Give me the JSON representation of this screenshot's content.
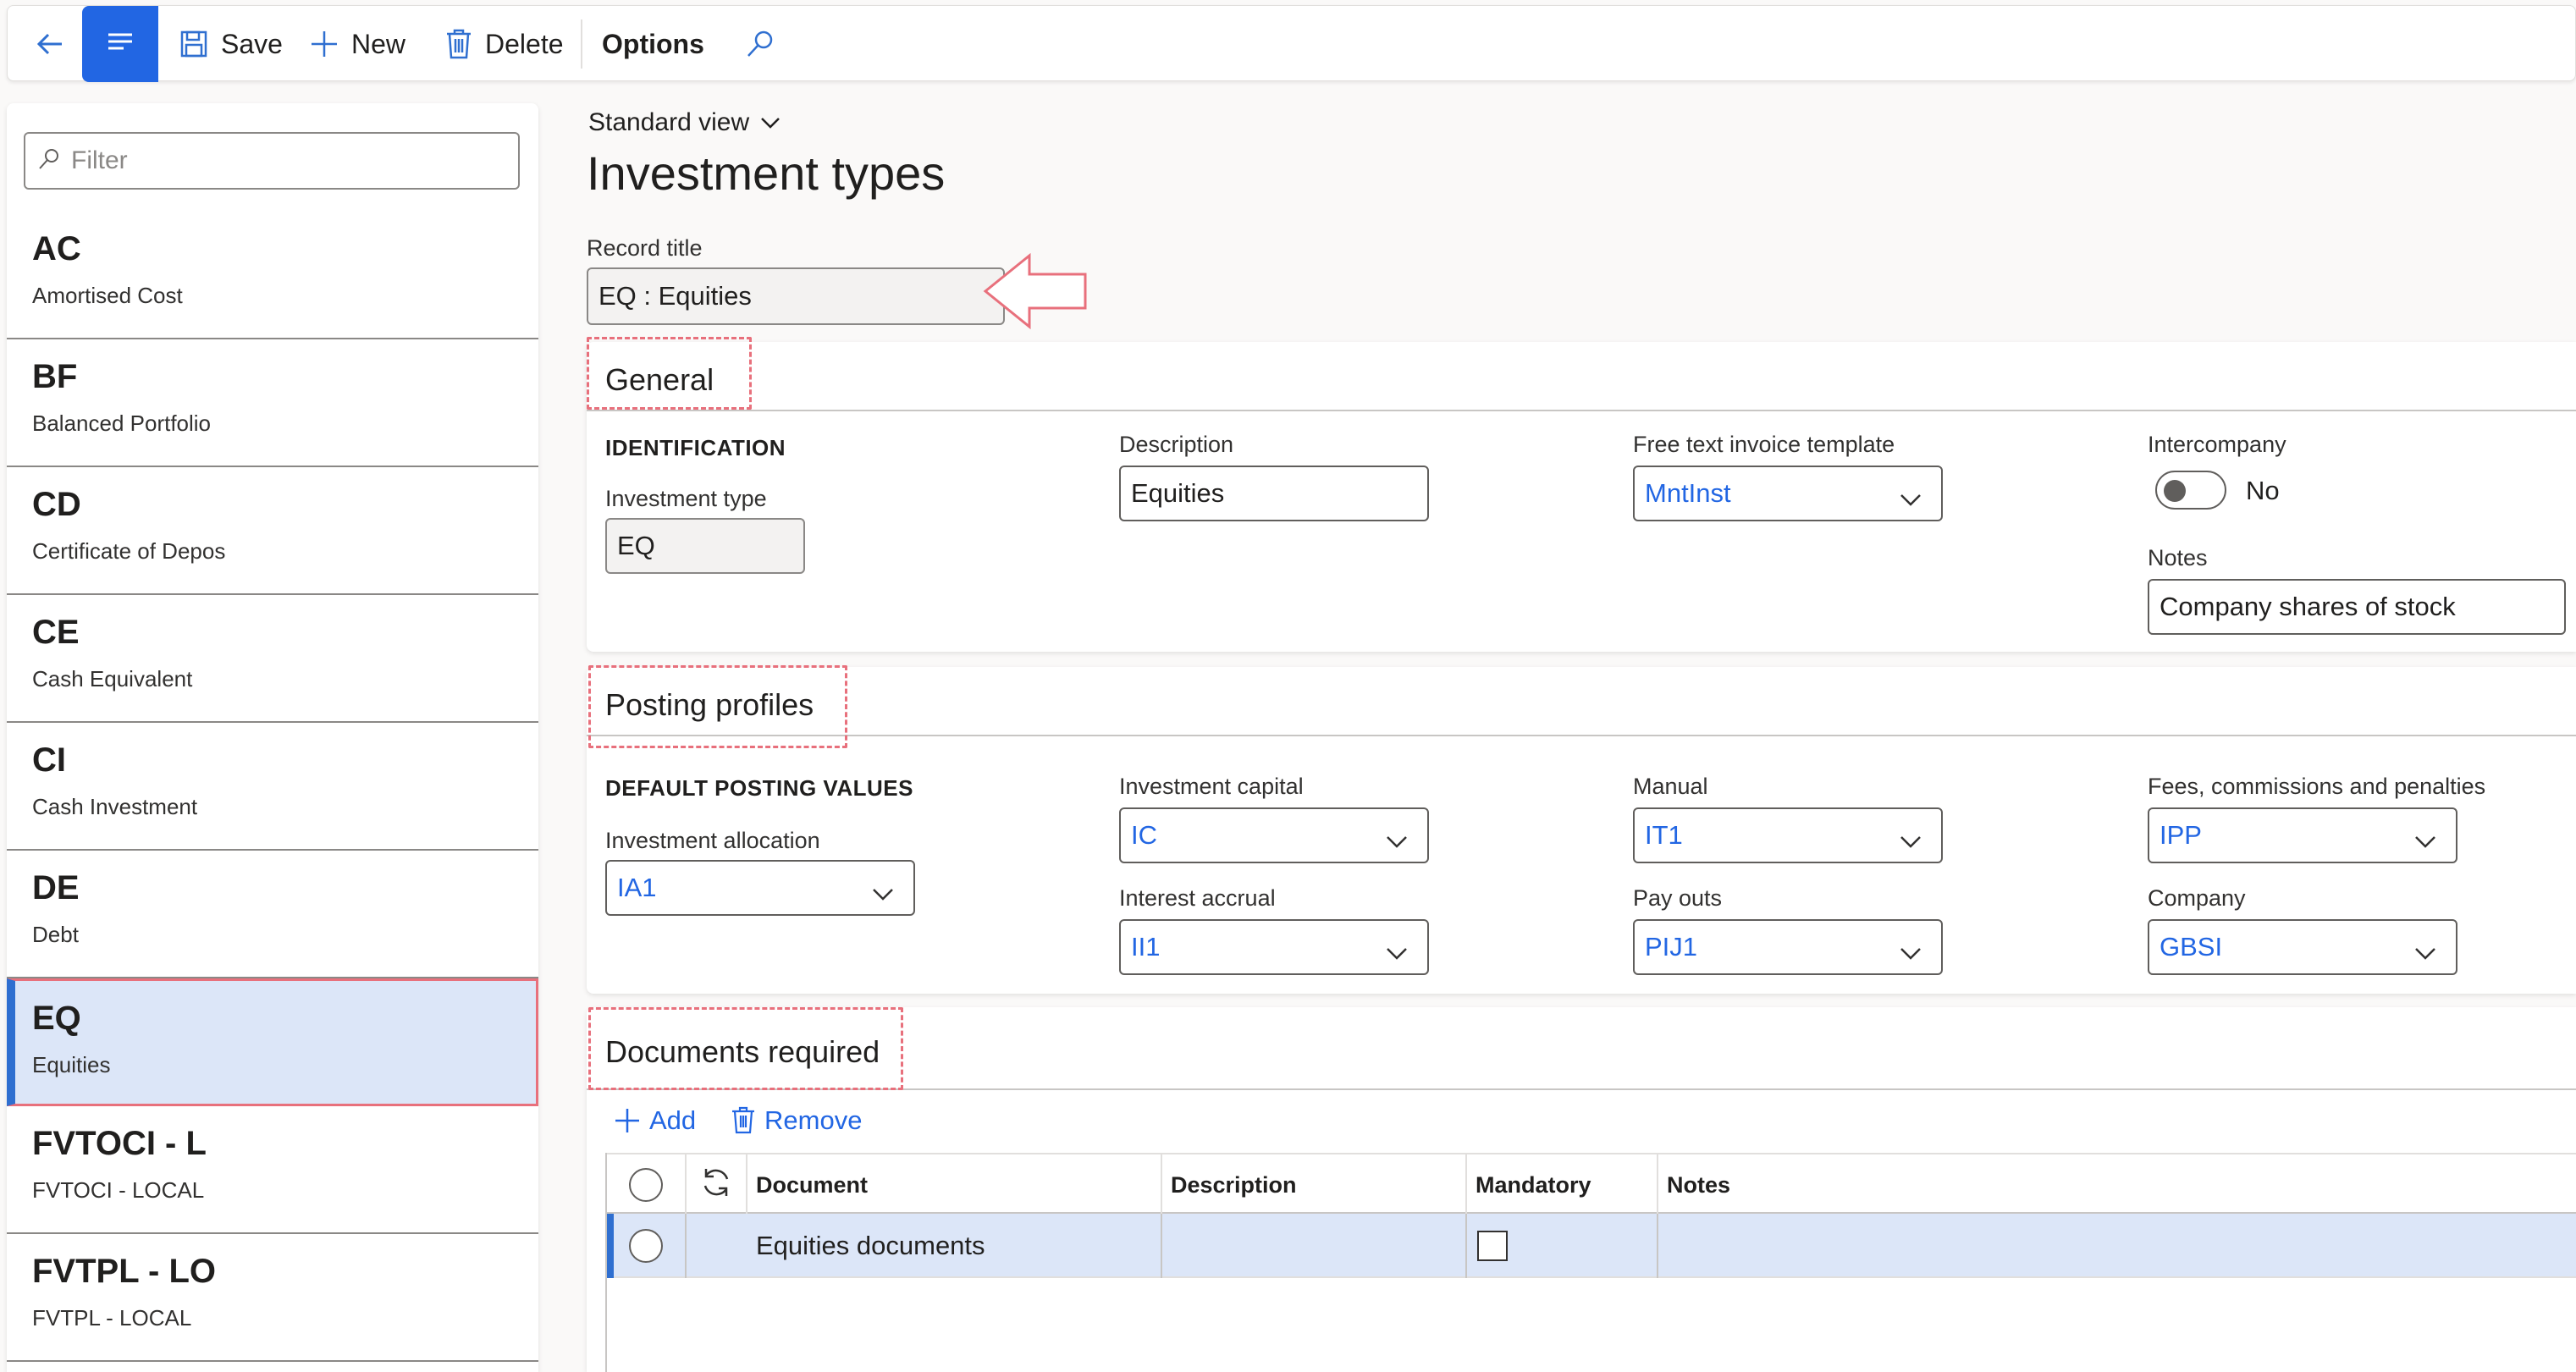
{
  "toolbar": {
    "save_label": "Save",
    "new_label": "New",
    "delete_label": "Delete",
    "options_label": "Options"
  },
  "list": {
    "filter_placeholder": "Filter",
    "items": [
      {
        "code": "AC",
        "desc": "Amortised Cost"
      },
      {
        "code": "BF",
        "desc": "Balanced Portfolio"
      },
      {
        "code": "CD",
        "desc": "Certificate of Depos"
      },
      {
        "code": "CE",
        "desc": "Cash Equivalent"
      },
      {
        "code": "CI",
        "desc": "Cash Investment"
      },
      {
        "code": "DE",
        "desc": "Debt"
      },
      {
        "code": "EQ",
        "desc": "Equities"
      },
      {
        "code": "FVTOCI - L",
        "desc": "FVTOCI - LOCAL"
      },
      {
        "code": "FVTPL - LO",
        "desc": "FVTPL - LOCAL"
      }
    ],
    "selected_code": "EQ"
  },
  "main": {
    "view_label": "Standard view",
    "title": "Investment types",
    "record_title_label": "Record title",
    "record_title_value": "EQ : Equities"
  },
  "general": {
    "title": "General",
    "identification_caption": "IDENTIFICATION",
    "investment_type_label": "Investment type",
    "investment_type_value": "EQ",
    "description_label": "Description",
    "description_value": "Equities",
    "free_text_label": "Free text invoice template",
    "free_text_value": "MntInst",
    "intercompany_label": "Intercompany",
    "intercompany_value": "No",
    "notes_label": "Notes",
    "notes_value": "Company shares of stock"
  },
  "posting": {
    "title": "Posting profiles",
    "default_caption": "DEFAULT POSTING VALUES",
    "allocation_label": "Investment allocation",
    "allocation_value": "IA1",
    "capital_label": "Investment capital",
    "capital_value": "IC",
    "accrual_label": "Interest accrual",
    "accrual_value": "II1",
    "manual_label": "Manual",
    "manual_value": "IT1",
    "payouts_label": "Pay outs",
    "payouts_value": "PIJ1",
    "fees_label": "Fees, commissions and penalties",
    "fees_value": "IPP",
    "company_label": "Company",
    "company_value": "GBSI"
  },
  "documents": {
    "title": "Documents required",
    "add_label": "Add",
    "remove_label": "Remove",
    "columns": [
      "Document",
      "Description",
      "Mandatory",
      "Notes"
    ],
    "rows": [
      {
        "document": "Equities documents",
        "description": "",
        "mandatory": false,
        "notes": ""
      }
    ]
  },
  "colors": {
    "accent": "#2266e3",
    "highlight": "#e8707c",
    "selected_bg": "#dce6f8"
  }
}
